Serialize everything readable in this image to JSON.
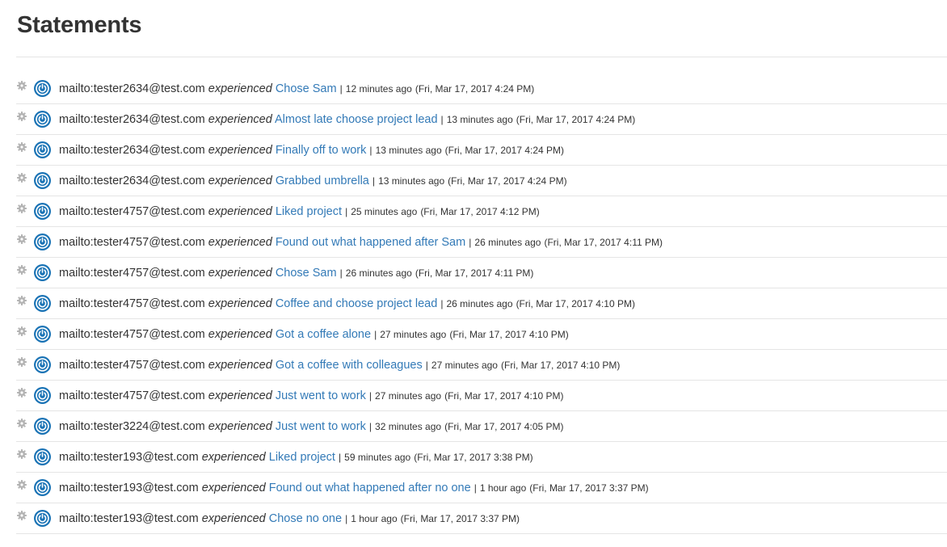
{
  "page": {
    "title": "Statements"
  },
  "colors": {
    "link": "#337ab7",
    "icon_blue": "#1a73b5",
    "gear_gray": "#b3b3b3",
    "divider": "#e5e5e5"
  },
  "icons": {
    "settings": "gear-icon",
    "actor": "power-icon"
  },
  "statements": [
    {
      "actor": "mailto:tester2634@test.com",
      "verb": "experienced",
      "activity": "Chose Sam",
      "separator": "|",
      "relative_time": "12 minutes ago",
      "timestamp": "(Fri, Mar 17, 2017 4:24 PM)"
    },
    {
      "actor": "mailto:tester2634@test.com",
      "verb": "experienced",
      "activity": "Almost late choose project lead",
      "separator": "|",
      "relative_time": "13 minutes ago",
      "timestamp": "(Fri, Mar 17, 2017 4:24 PM)"
    },
    {
      "actor": "mailto:tester2634@test.com",
      "verb": "experienced",
      "activity": "Finally off to work",
      "separator": "|",
      "relative_time": "13 minutes ago",
      "timestamp": "(Fri, Mar 17, 2017 4:24 PM)"
    },
    {
      "actor": "mailto:tester2634@test.com",
      "verb": "experienced",
      "activity": "Grabbed umbrella",
      "separator": "|",
      "relative_time": "13 minutes ago",
      "timestamp": "(Fri, Mar 17, 2017 4:24 PM)"
    },
    {
      "actor": "mailto:tester4757@test.com",
      "verb": "experienced",
      "activity": "Liked project",
      "separator": "|",
      "relative_time": "25 minutes ago",
      "timestamp": "(Fri, Mar 17, 2017 4:12 PM)"
    },
    {
      "actor": "mailto:tester4757@test.com",
      "verb": "experienced",
      "activity": "Found out what happened after Sam",
      "separator": "|",
      "relative_time": "26 minutes ago",
      "timestamp": "(Fri, Mar 17, 2017 4:11 PM)"
    },
    {
      "actor": "mailto:tester4757@test.com",
      "verb": "experienced",
      "activity": "Chose Sam",
      "separator": "|",
      "relative_time": "26 minutes ago",
      "timestamp": "(Fri, Mar 17, 2017 4:11 PM)"
    },
    {
      "actor": "mailto:tester4757@test.com",
      "verb": "experienced",
      "activity": "Coffee and choose project lead",
      "separator": "|",
      "relative_time": "26 minutes ago",
      "timestamp": "(Fri, Mar 17, 2017 4:10 PM)"
    },
    {
      "actor": "mailto:tester4757@test.com",
      "verb": "experienced",
      "activity": "Got a coffee alone",
      "separator": "|",
      "relative_time": "27 minutes ago",
      "timestamp": "(Fri, Mar 17, 2017 4:10 PM)"
    },
    {
      "actor": "mailto:tester4757@test.com",
      "verb": "experienced",
      "activity": "Got a coffee with colleagues",
      "separator": "|",
      "relative_time": "27 minutes ago",
      "timestamp": "(Fri, Mar 17, 2017 4:10 PM)"
    },
    {
      "actor": "mailto:tester4757@test.com",
      "verb": "experienced",
      "activity": "Just went to work",
      "separator": "|",
      "relative_time": "27 minutes ago",
      "timestamp": "(Fri, Mar 17, 2017 4:10 PM)"
    },
    {
      "actor": "mailto:tester3224@test.com",
      "verb": "experienced",
      "activity": "Just went to work",
      "separator": "|",
      "relative_time": "32 minutes ago",
      "timestamp": "(Fri, Mar 17, 2017 4:05 PM)"
    },
    {
      "actor": "mailto:tester193@test.com",
      "verb": "experienced",
      "activity": "Liked project",
      "separator": "|",
      "relative_time": "59 minutes ago",
      "timestamp": "(Fri, Mar 17, 2017 3:38 PM)"
    },
    {
      "actor": "mailto:tester193@test.com",
      "verb": "experienced",
      "activity": "Found out what happened after no one",
      "separator": "|",
      "relative_time": "1 hour ago",
      "timestamp": "(Fri, Mar 17, 2017 3:37 PM)"
    },
    {
      "actor": "mailto:tester193@test.com",
      "verb": "experienced",
      "activity": "Chose no one",
      "separator": "|",
      "relative_time": "1 hour ago",
      "timestamp": "(Fri, Mar 17, 2017 3:37 PM)"
    }
  ]
}
